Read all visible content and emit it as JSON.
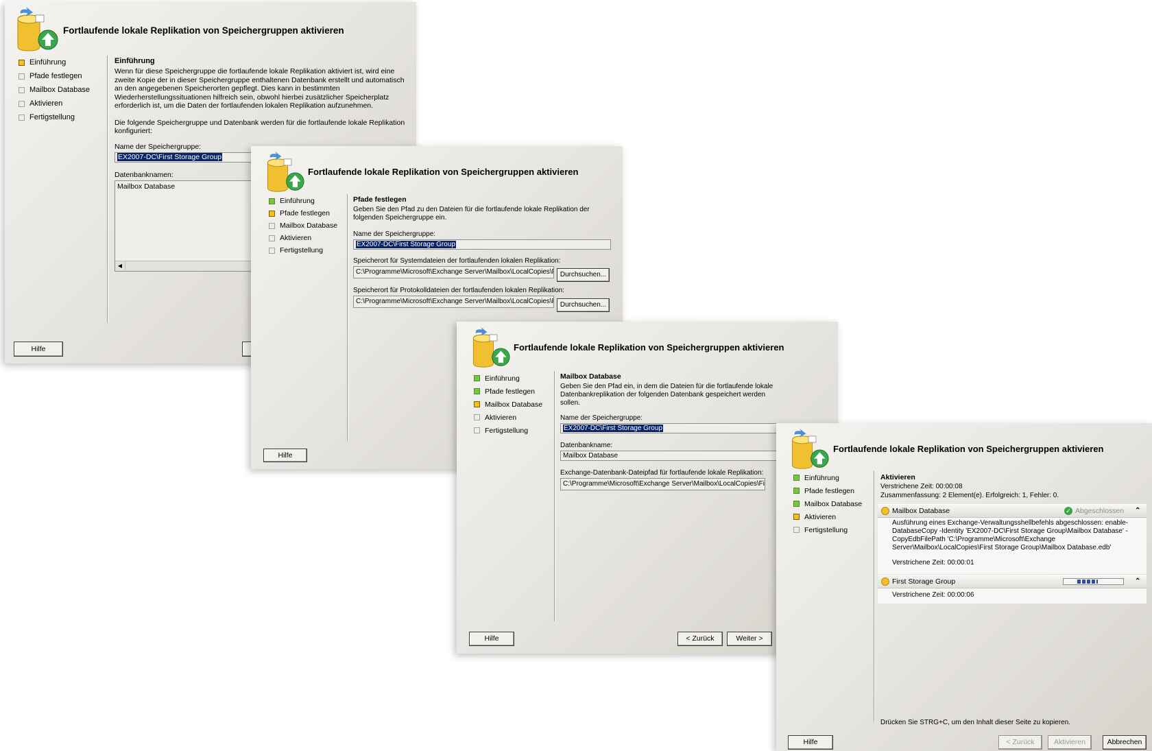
{
  "window_title": "Fortlaufende lokale Replikation von Speichergruppen aktivieren",
  "steps": [
    "Einführung",
    "Pfade festlegen",
    "Mailbox Database",
    "Aktivieren",
    "Fertigstellung"
  ],
  "buttons": {
    "help": "Hilfe",
    "back": "< Zurück",
    "next": "Weiter >",
    "activate": "Aktivieren",
    "cancel": "Abbrechen",
    "browse": "Durchsuchen..."
  },
  "win1": {
    "heading": "Einführung",
    "intro": "Wenn für diese Speichergruppe die fortlaufende lokale Replikation aktiviert ist, wird eine zweite Kopie der in dieser Speichergruppe enthaltenen Datenbank erstellt und automatisch an den angegebenen Speicherorten gepflegt. Dies kann in bestimmten Wiederherstellungssituationen hilfreich sein, obwohl hierbei zusätzlicher Speicherplatz erforderlich ist, um die Daten der fortlaufenden lokalen Replikation aufzunehmen.",
    "config_text": "Die folgende Speichergruppe und Datenbank werden für die fortlaufende lokale Replikation konfiguriert:",
    "sg_label": "Name der Speichergruppe:",
    "sg_value": "EX2007-DC\\First Storage Group",
    "db_label": "Datenbanknamen:",
    "db_value": "Mailbox Database"
  },
  "win2": {
    "heading": "Pfade festlegen",
    "desc": "Geben Sie den Pfad zu den Dateien für die fortlaufende lokale Replikation der folgenden Speichergruppe ein.",
    "sg_label": "Name der Speichergruppe:",
    "sg_value": "EX2007-DC\\First Storage Group",
    "sys_label": "Speicherort für Systemdateien der fortlaufenden lokalen Replikation:",
    "sys_value": "C:\\Programme\\Microsoft\\Exchange Server\\Mailbox\\LocalCopies\\First",
    "log_label": "Speicherort für Protokolldateien der fortlaufenden lokalen Replikation:",
    "log_value": "C:\\Programme\\Microsoft\\Exchange Server\\Mailbox\\LocalCopies\\First"
  },
  "win3": {
    "heading": "Mailbox Database",
    "desc": "Geben Sie den Pfad ein, in dem die Dateien für die fortlaufende lokale Datenbankreplikation der folgenden Datenbank gespeichert werden sollen.",
    "sg_label": "Name der Speichergruppe:",
    "sg_value": "EX2007-DC\\First Storage Group",
    "db_label": "Datenbankname:",
    "db_value": "Mailbox Database",
    "path_label": "Exchange-Datenbank-Dateipfad für fortlaufende lokale Replikation:",
    "path_value": "C:\\Programme\\Microsoft\\Exchange Server\\Mailbox\\LocalCopies\\First"
  },
  "win4": {
    "heading": "Aktivieren",
    "elapsed": "Verstrichene Zeit: 00:00:08",
    "summary": "Zusammenfassung: 2 Element(e). Erfolgreich: 1, Fehler: 0.",
    "item1_name": "Mailbox Database",
    "item1_status": "Abgeschlossen",
    "item1_detail": "Ausführung eines Exchange-Verwaltungsshellbefehls abgeschlossen: enable-DatabaseCopy -Identity 'EX2007-DC\\First Storage Group\\Mailbox Database' -CopyEdbFilePath 'C:\\Programme\\Microsoft\\Exchange Server\\Mailbox\\LocalCopies\\First Storage Group\\Mailbox Database.edb'",
    "item1_elapsed": "Verstrichene Zeit: 00:00:01",
    "item2_name": "First Storage Group",
    "item2_elapsed": "Verstrichene Zeit: 00:00:06",
    "footer": "Drücken Sie STRG+C, um den Inhalt dieser Seite zu kopieren."
  }
}
